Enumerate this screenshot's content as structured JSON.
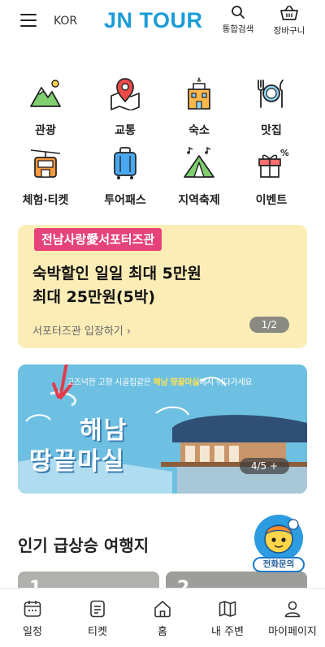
{
  "header": {
    "language": "KOR",
    "logo": "JN TOUR",
    "search_label": "통합검색",
    "cart_label": "장바구니",
    "icons": [
      "menu-icon",
      "search-icon",
      "cart-icon"
    ]
  },
  "categories": [
    {
      "label": "관광",
      "icon": "mountain-icon"
    },
    {
      "label": "교통",
      "icon": "map-pin-icon"
    },
    {
      "label": "숙소",
      "icon": "hotel-icon"
    },
    {
      "label": "맛집",
      "icon": "dining-icon"
    },
    {
      "label": "체험·티켓",
      "icon": "cable-car-icon"
    },
    {
      "label": "투어패스",
      "icon": "luggage-icon"
    },
    {
      "label": "지역축제",
      "icon": "festival-tent-icon"
    },
    {
      "label": "이벤트",
      "icon": "gift-icon"
    }
  ],
  "promo": {
    "tag": "전남사랑愛서포터즈관",
    "title_line1": "숙박할인 일일 최대 5만원",
    "title_line2": "최대 25만원(5박)",
    "link": "서포터즈관 입장하기",
    "pager": "1/2",
    "bg_color": "#fcedb7",
    "tag_color": "#e5437a"
  },
  "banner": {
    "sub_prefix": "고즈넉한 고향 시골집같은 ",
    "sub_highlight": "해남 땅끝마실",
    "sub_suffix": "에서 쉬다가세요",
    "big_line1": "해남",
    "big_line2": "땅끝마실",
    "pager": "4/5 +"
  },
  "popular": {
    "title": "인기 급상승 여행지",
    "ranks": [
      "1",
      "2"
    ]
  },
  "call_button": {
    "label": "전화문의"
  },
  "bottom_nav": [
    {
      "label": "일정",
      "icon": "calendar-icon"
    },
    {
      "label": "티켓",
      "icon": "ticket-icon"
    },
    {
      "label": "홈",
      "icon": "home-icon"
    },
    {
      "label": "내 주변",
      "icon": "map-icon"
    },
    {
      "label": "마이페이지",
      "icon": "user-icon"
    }
  ],
  "colors": {
    "brand": "#1a9cd8",
    "promo_tag": "#e5437a"
  }
}
